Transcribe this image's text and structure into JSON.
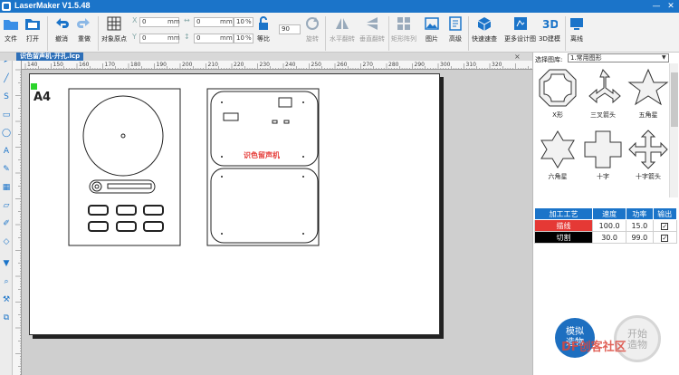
{
  "app": {
    "title": "LaserMaker V1.5.48"
  },
  "toolbar": {
    "file": "文件",
    "open": "打开",
    "undo": "撤消",
    "redo": "重做",
    "align": "对象原点",
    "x_label": "X",
    "y_label": "Y",
    "x_value": "0",
    "y_value": "0",
    "w_value": "0",
    "h_value": "0",
    "unit_mm": "mm",
    "pct_w": "10",
    "pct_h": "10",
    "pct_unit": "%",
    "ratio": "等比",
    "rotate_value": "90",
    "rotate": "旋转",
    "hflip": "水平翻转",
    "vflip": "垂直翻转",
    "array": "矩形阵列",
    "image": "图片",
    "advanced": "高级",
    "quick": "快速速查",
    "more_design": "更多设计图",
    "d3": "3D建模",
    "offline": "离线"
  },
  "tab": {
    "label": "识色留声机-开孔.lcp",
    "close": "×"
  },
  "ruler": {
    "top": [
      "140",
      "150",
      "160",
      "170",
      "180",
      "190",
      "200",
      "210",
      "220",
      "230",
      "240",
      "250",
      "260",
      "270",
      "280",
      "290",
      "300",
      "310",
      "320"
    ]
  },
  "canvas": {
    "page_label": "A4",
    "device_text": "识色留声机"
  },
  "right_panel": {
    "library_label": "选择图库:",
    "library_value": "1.常用图形",
    "shapes": [
      "X形",
      "三叉箭头",
      "五角星",
      "六角星",
      "十字",
      "十字箭头"
    ]
  },
  "process_table": {
    "headers": [
      "加工工艺",
      "速度",
      "功率",
      "输出"
    ],
    "rows": [
      {
        "name": "描线",
        "speed": "100.0",
        "power": "15.0",
        "color": "#e53935",
        "text_color": "#ffffff"
      },
      {
        "name": "切割",
        "speed": "30.0",
        "power": "99.0",
        "color": "#000000",
        "text_color": "#ffffff"
      }
    ]
  },
  "buttons": {
    "simulate": "模拟造物",
    "simulate_l1": "模拟",
    "simulate_l2": "造物",
    "start_l1": "开始",
    "start_l2": "造物"
  },
  "watermark": "DF创客社区"
}
